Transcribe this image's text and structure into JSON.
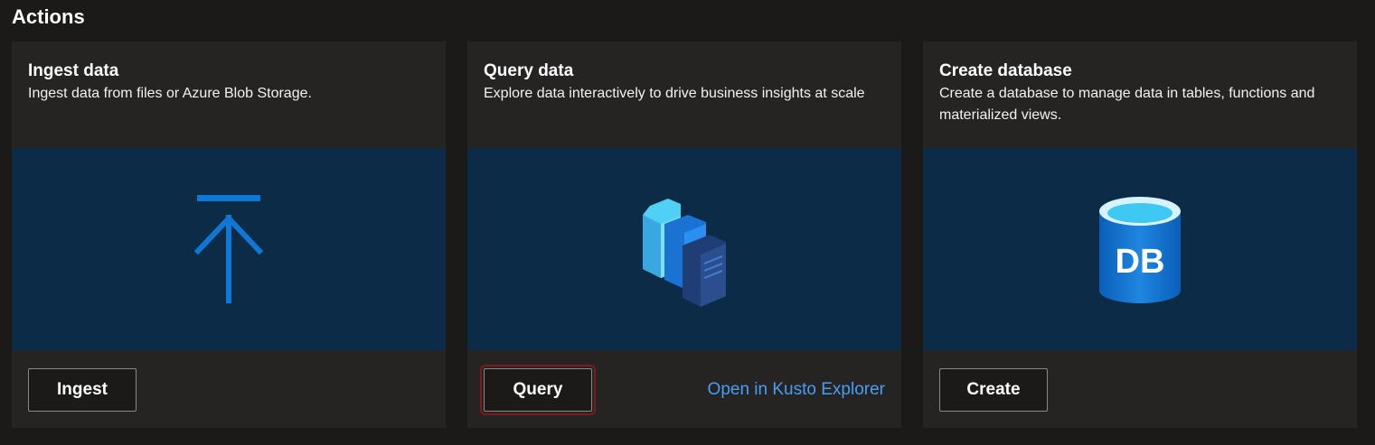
{
  "section": {
    "title": "Actions"
  },
  "cards": [
    {
      "title": "Ingest data",
      "description": "Ingest data from files or Azure Blob Storage.",
      "icon": "upload-arrow-icon",
      "button_label": "Ingest"
    },
    {
      "title": "Query data",
      "description": "Explore data interactively to drive business insights at scale",
      "icon": "documents-query-icon",
      "button_label": "Query",
      "link_label": "Open in Kusto Explorer"
    },
    {
      "title": "Create database",
      "description": "Create a database to manage data in tables, functions and materialized views.",
      "icon": "database-icon",
      "icon_text": "DB",
      "button_label": "Create"
    }
  ],
  "colors": {
    "page_background": "#1b1a19",
    "card_background": "#252423",
    "art_background": "#0b2b47",
    "accent_blue": "#0f78d4",
    "link_blue": "#479ef5"
  }
}
